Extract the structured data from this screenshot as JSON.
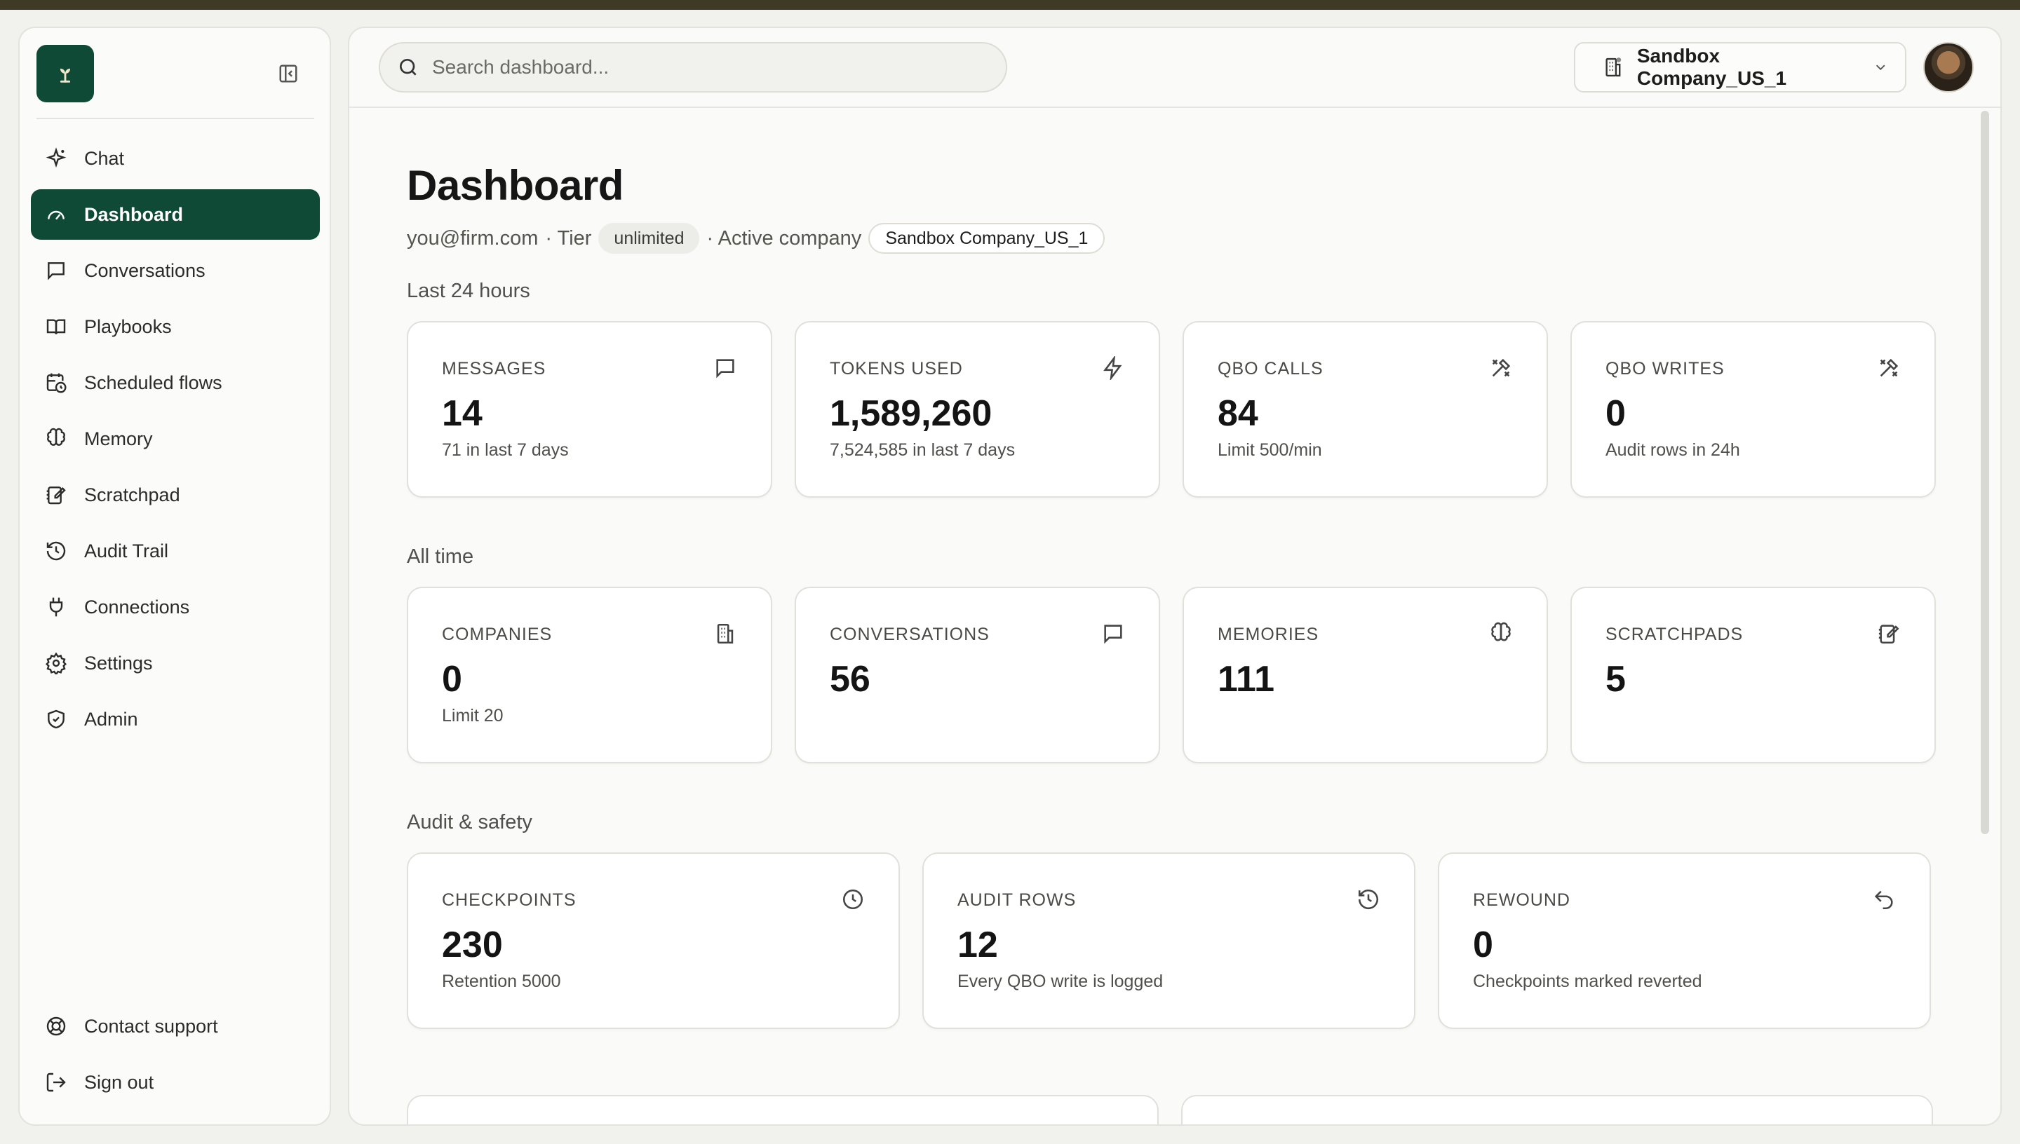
{
  "sidebar": {
    "items": [
      {
        "label": "Chat",
        "icon": "sparkle-icon"
      },
      {
        "label": "Dashboard",
        "icon": "gauge-icon",
        "active": true
      },
      {
        "label": "Conversations",
        "icon": "message-icon"
      },
      {
        "label": "Playbooks",
        "icon": "book-icon"
      },
      {
        "label": "Scheduled flows",
        "icon": "calendar-clock-icon"
      },
      {
        "label": "Memory",
        "icon": "brain-icon"
      },
      {
        "label": "Scratchpad",
        "icon": "notepad-icon"
      },
      {
        "label": "Audit Trail",
        "icon": "history-icon"
      },
      {
        "label": "Connections",
        "icon": "plug-icon"
      },
      {
        "label": "Settings",
        "icon": "gear-icon"
      },
      {
        "label": "Admin",
        "icon": "shield-icon"
      }
    ],
    "bottom": [
      {
        "label": "Contact support",
        "icon": "lifebuoy-icon"
      },
      {
        "label": "Sign out",
        "icon": "sign-out-icon"
      }
    ]
  },
  "header": {
    "search_placeholder": "Search dashboard...",
    "company": "Sandbox Company_US_1"
  },
  "page": {
    "title": "Dashboard",
    "email": "you@firm.com",
    "tier_label": "· Tier",
    "tier": "unlimited",
    "active_label": "· Active company",
    "active_company": "Sandbox Company_US_1"
  },
  "sections": {
    "last24": {
      "label": "Last 24 hours",
      "cards": [
        {
          "label": "MESSAGES",
          "value": "14",
          "sub": "71 in last 7 days",
          "icon": "message-icon"
        },
        {
          "label": "TOKENS USED",
          "value": "1,589,260",
          "sub": "7,524,585 in last 7 days",
          "icon": "lightning-icon"
        },
        {
          "label": "QBO CALLS",
          "value": "84",
          "sub": "Limit 500/min",
          "icon": "tools-icon"
        },
        {
          "label": "QBO WRITES",
          "value": "0",
          "sub": "Audit rows in 24h",
          "icon": "tools-icon"
        }
      ]
    },
    "alltime": {
      "label": "All time",
      "cards": [
        {
          "label": "COMPANIES",
          "value": "0",
          "sub": "Limit 20",
          "icon": "building-icon"
        },
        {
          "label": "CONVERSATIONS",
          "value": "56",
          "sub": "",
          "icon": "message-icon"
        },
        {
          "label": "MEMORIES",
          "value": "111",
          "sub": "",
          "icon": "brain-icon"
        },
        {
          "label": "SCRATCHPADS",
          "value": "5",
          "sub": "",
          "icon": "notepad-icon"
        }
      ]
    },
    "audit": {
      "label": "Audit & safety",
      "cards": [
        {
          "label": "CHECKPOINTS",
          "value": "230",
          "sub": "Retention 5000",
          "icon": "clock-icon"
        },
        {
          "label": "AUDIT ROWS",
          "value": "12",
          "sub": "Every QBO write is logged",
          "icon": "history-icon"
        },
        {
          "label": "REWOUND",
          "value": "0",
          "sub": "Checkpoints marked reverted",
          "icon": "undo-icon"
        }
      ]
    }
  },
  "colors": {
    "brand": "#0f4a36",
    "background": "#f1f1ee",
    "panel": "#fafaf8",
    "card_border": "#e1e0da"
  }
}
